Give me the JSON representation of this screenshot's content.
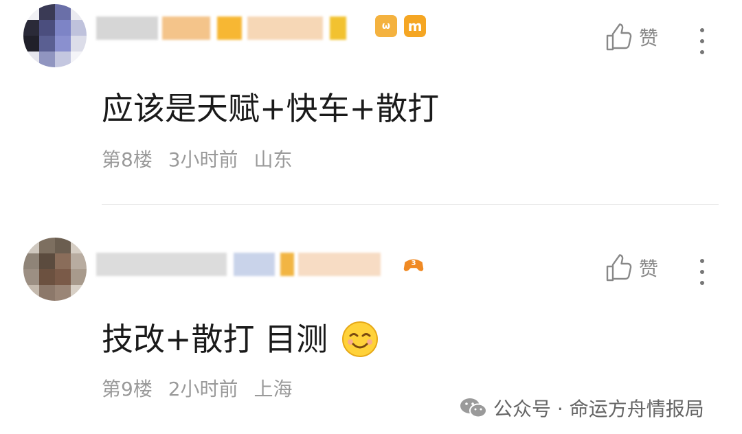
{
  "comments": [
    {
      "like_label": "赞",
      "text": "应该是天赋+快车+散打",
      "floor": "第8楼",
      "time": "3小时前",
      "location": "山东",
      "badge_text": "m",
      "icons": [
        "thumbs-up-icon",
        "more-vertical-icon"
      ]
    },
    {
      "like_label": "赞",
      "text": "技改+散打 目测",
      "floor": "第9楼",
      "time": "2小时前",
      "location": "上海",
      "emoji": "smile-emoji",
      "icons": [
        "thumbs-up-icon",
        "more-vertical-icon"
      ]
    }
  ],
  "watermark": {
    "text": "公众号 · 命运方舟情报局",
    "icon": "wechat-icon"
  },
  "colors": {
    "text_primary": "#1a1a1a",
    "text_secondary": "#9a9a9a",
    "divider": "#e4e4e4",
    "badge_orange": "#f5a623"
  }
}
